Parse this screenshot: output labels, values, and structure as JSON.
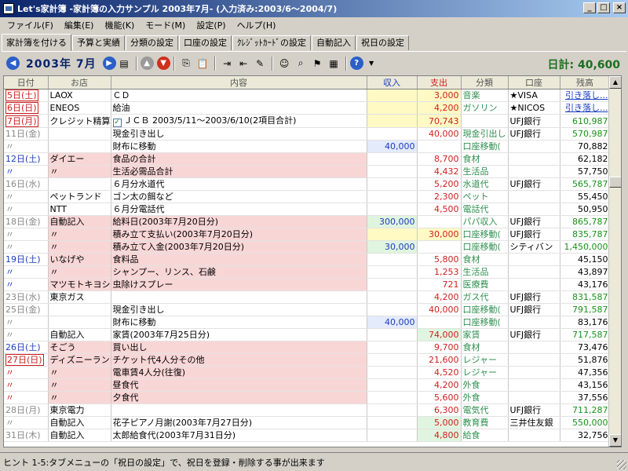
{
  "window": {
    "title": "Let's家計簿 -家計簿の入力サンプル 2003年7月- (入力済み:2003/6～2004/7)"
  },
  "menu": [
    "ファイル(F)",
    "編集(E)",
    "機能(K)",
    "モード(M)",
    "設定(P)",
    "ヘルプ(H)"
  ],
  "tabs": [
    "家計簿を付ける",
    "予算と実績",
    "分類の設定",
    "口座の設定",
    "ｸﾚｼﾞｯﾄｶｰﾄﾞの設定",
    "自動記入",
    "祝日の設定"
  ],
  "toolbar": {
    "month": "2003年 7月",
    "daily_total": "日計: 40,600"
  },
  "columns": [
    "日付",
    "お店",
    "内容",
    "収入",
    "支出",
    "分類",
    "口座",
    "残高"
  ],
  "rows": [
    {
      "date": "5日(土)",
      "dstyle": "box",
      "shop": "LAOX",
      "desc": "ＣＤ",
      "income": "",
      "expense": "3,000",
      "cat": "音楽",
      "acct": "★VISA",
      "bal": "引き落し...",
      "pink": false,
      "grp": true,
      "expbg": "yellow",
      "balstyle": "link"
    },
    {
      "date": "6日(日)",
      "dstyle": "box",
      "shop": "ENEOS",
      "desc": "給油",
      "income": "",
      "expense": "4,200",
      "cat": "ガソリン",
      "acct": "★NICOS",
      "bal": "引き落し...",
      "pink": false,
      "grp": true,
      "expbg": "yellow",
      "balstyle": "link"
    },
    {
      "date": "7日(月)",
      "dstyle": "box",
      "shop": "クレジット精算",
      "desc": "ＪＣＢ 2003/5/11～2003/6/10(2項目合計)",
      "income": "",
      "expense": "70,743",
      "cat": "",
      "acct": "UFJ銀行",
      "bal": "610,987",
      "pink": false,
      "grp": true,
      "expbg": "yellow",
      "balstyle": "green",
      "check": true
    },
    {
      "date": "11日(金)",
      "dstyle": "gray",
      "shop": "",
      "desc": "現金引き出し",
      "income": "",
      "expense": "40,000",
      "cat": "現金引出し",
      "acct": "UFJ銀行",
      "bal": "570,987",
      "pink": false,
      "grp": true,
      "expbg": "",
      "balstyle": "green"
    },
    {
      "date": "〃",
      "dstyle": "gray",
      "shop": "",
      "desc": "財布に移動",
      "income": "40,000",
      "expense": "",
      "cat": "口座移動(",
      "acct": "",
      "bal": "70,882",
      "pink": false,
      "grp": false,
      "expbg": "",
      "balstyle": ""
    },
    {
      "date": "12日(土)",
      "dstyle": "blue",
      "shop": "ダイエー",
      "desc": "食品の合計",
      "income": "",
      "expense": "8,700",
      "cat": "食材",
      "acct": "",
      "bal": "62,182",
      "pink": true,
      "grp": true,
      "expbg": "",
      "balstyle": ""
    },
    {
      "date": "〃",
      "dstyle": "blue",
      "shop": "〃",
      "desc": "生活必需品合計",
      "income": "",
      "expense": "4,432",
      "cat": "生活品",
      "acct": "",
      "bal": "57,750",
      "pink": true,
      "grp": false,
      "expbg": "",
      "balstyle": ""
    },
    {
      "date": "16日(水)",
      "dstyle": "gray",
      "shop": "",
      "desc": "６月分水道代",
      "income": "",
      "expense": "5,200",
      "cat": "水道代",
      "acct": "UFJ銀行",
      "bal": "565,787",
      "pink": false,
      "grp": true,
      "expbg": "",
      "balstyle": "green"
    },
    {
      "date": "〃",
      "dstyle": "gray",
      "shop": "ペットランド",
      "desc": "ゴン太の餌など",
      "income": "",
      "expense": "2,300",
      "cat": "ペット",
      "acct": "",
      "bal": "55,450",
      "pink": false,
      "grp": false,
      "expbg": "",
      "balstyle": ""
    },
    {
      "date": "〃",
      "dstyle": "gray",
      "shop": "NTT",
      "desc": "６月分電話代",
      "income": "",
      "expense": "4,500",
      "cat": "電話代",
      "acct": "",
      "bal": "50,950",
      "pink": false,
      "grp": false,
      "expbg": "",
      "balstyle": ""
    },
    {
      "date": "18日(金)",
      "dstyle": "gray",
      "shop": "自動記入",
      "desc": "給料日(2003年7月20日分)",
      "income": "300,000",
      "expense": "",
      "cat": "パパ収入",
      "acct": "UFJ銀行",
      "bal": "865,787",
      "pink": true,
      "grp": true,
      "expbg": "",
      "incbg": "green",
      "balstyle": "green"
    },
    {
      "date": "〃",
      "dstyle": "gray",
      "shop": "〃",
      "desc": "積み立て支払い(2003年7月20日分)",
      "income": "",
      "expense": "30,000",
      "cat": "口座移動(",
      "acct": "UFJ銀行",
      "bal": "835,787",
      "pink": true,
      "grp": false,
      "expbg": "yellow",
      "balstyle": "green"
    },
    {
      "date": "〃",
      "dstyle": "gray",
      "shop": "〃",
      "desc": "積み立て入金(2003年7月20日分)",
      "income": "30,000",
      "expense": "",
      "cat": "口座移動(",
      "acct": "シティバン",
      "bal": "1,450,000",
      "pink": true,
      "grp": false,
      "expbg": "",
      "incbg": "green",
      "balstyle": "green"
    },
    {
      "date": "19日(土)",
      "dstyle": "blue",
      "shop": "いなげや",
      "desc": "食料品",
      "income": "",
      "expense": "5,800",
      "cat": "食材",
      "acct": "",
      "bal": "45,150",
      "pink": true,
      "grp": true,
      "expbg": "",
      "balstyle": ""
    },
    {
      "date": "〃",
      "dstyle": "blue",
      "shop": "〃",
      "desc": "シャンプー、リンス、石鹸",
      "income": "",
      "expense": "1,253",
      "cat": "生活品",
      "acct": "",
      "bal": "43,897",
      "pink": true,
      "grp": false,
      "expbg": "",
      "balstyle": ""
    },
    {
      "date": "〃",
      "dstyle": "blue",
      "shop": "マツモトキヨシ",
      "desc": "虫除けスプレー",
      "income": "",
      "expense": "721",
      "cat": "医療費",
      "acct": "",
      "bal": "43,176",
      "pink": true,
      "grp": false,
      "expbg": "",
      "balstyle": ""
    },
    {
      "date": "23日(水)",
      "dstyle": "gray",
      "shop": "東京ガス",
      "desc": "",
      "income": "",
      "expense": "4,200",
      "cat": "ガス代",
      "acct": "UFJ銀行",
      "bal": "831,587",
      "pink": false,
      "grp": true,
      "expbg": "",
      "balstyle": "green"
    },
    {
      "date": "25日(金)",
      "dstyle": "gray",
      "shop": "",
      "desc": "現金引き出し",
      "income": "",
      "expense": "40,000",
      "cat": "口座移動(",
      "acct": "UFJ銀行",
      "bal": "791,587",
      "pink": false,
      "grp": true,
      "expbg": "",
      "balstyle": "green"
    },
    {
      "date": "〃",
      "dstyle": "gray",
      "shop": "",
      "desc": "財布に移動",
      "income": "40,000",
      "expense": "",
      "cat": "口座移動(",
      "acct": "",
      "bal": "83,176",
      "pink": false,
      "grp": false,
      "expbg": "",
      "balstyle": ""
    },
    {
      "date": "〃",
      "dstyle": "gray",
      "shop": "自動記入",
      "desc": "家賃(2003年7月25日分)",
      "income": "",
      "expense": "74,000",
      "cat": "家賃",
      "acct": "UFJ銀行",
      "bal": "717,587",
      "pink": false,
      "grp": false,
      "expbg": "green",
      "balstyle": "green"
    },
    {
      "date": "26日(土)",
      "dstyle": "blue",
      "shop": "そごう",
      "desc": "買い出し",
      "income": "",
      "expense": "9,700",
      "cat": "食材",
      "acct": "",
      "bal": "73,476",
      "pink": true,
      "grp": true,
      "expbg": "",
      "balstyle": ""
    },
    {
      "date": "27日(日)",
      "dstyle": "box",
      "shop": "ディズニーランド",
      "desc": "チケット代4人分その他",
      "income": "",
      "expense": "21,600",
      "cat": "レジャー",
      "acct": "",
      "bal": "51,876",
      "pink": true,
      "grp": true,
      "expbg": "",
      "balstyle": ""
    },
    {
      "date": "〃",
      "dstyle": "red",
      "shop": "〃",
      "desc": "電車賃4人分(往復)",
      "income": "",
      "expense": "4,520",
      "cat": "レジャー",
      "acct": "",
      "bal": "47,356",
      "pink": true,
      "grp": false,
      "expbg": "",
      "balstyle": ""
    },
    {
      "date": "〃",
      "dstyle": "red",
      "shop": "〃",
      "desc": "昼食代",
      "income": "",
      "expense": "4,200",
      "cat": "外食",
      "acct": "",
      "bal": "43,156",
      "pink": true,
      "grp": false,
      "expbg": "",
      "balstyle": ""
    },
    {
      "date": "〃",
      "dstyle": "red",
      "shop": "〃",
      "desc": "夕食代",
      "income": "",
      "expense": "5,600",
      "cat": "外食",
      "acct": "",
      "bal": "37,556",
      "pink": true,
      "grp": false,
      "expbg": "",
      "balstyle": ""
    },
    {
      "date": "28日(月)",
      "dstyle": "gray",
      "shop": "東京電力",
      "desc": "",
      "income": "",
      "expense": "6,300",
      "cat": "電気代",
      "acct": "UFJ銀行",
      "bal": "711,287",
      "pink": false,
      "grp": true,
      "expbg": "",
      "balstyle": "green"
    },
    {
      "date": "〃",
      "dstyle": "gray",
      "shop": "自動記入",
      "desc": "花子ピアノ月謝(2003年7月27日分)",
      "income": "",
      "expense": "5,000",
      "cat": "教育費",
      "acct": "三井住友銀",
      "bal": "550,000",
      "pink": false,
      "grp": false,
      "expbg": "green",
      "balstyle": "green"
    },
    {
      "date": "31日(木)",
      "dstyle": "gray",
      "shop": "自動記入",
      "desc": "太郎給食代(2003年7月31日分)",
      "income": "",
      "expense": "4,800",
      "cat": "給食",
      "acct": "",
      "bal": "32,756",
      "pink": false,
      "grp": true,
      "expbg": "green",
      "balstyle": ""
    }
  ],
  "status": "ヒント 1-5:タブメニューの「祝日の設定」で、祝日を登録・削除する事が出来ます",
  "icons": [
    "prev-month-icon",
    "next-month-icon",
    "calendar-icon",
    "up-icon",
    "down-icon",
    "copy-icon",
    "paste-icon",
    "indent-icon",
    "outdent-icon",
    "wand-icon",
    "person-icon",
    "search-icon",
    "flag-icon",
    "chart-icon",
    "help-icon"
  ]
}
